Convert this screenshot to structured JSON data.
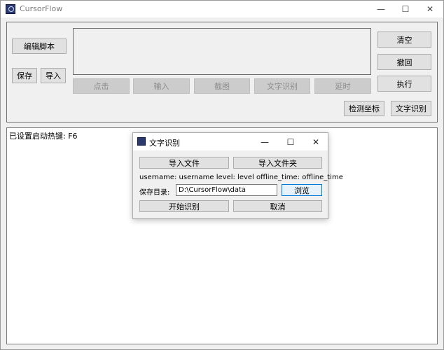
{
  "window": {
    "title": "CursorFlow",
    "minimize": "—",
    "maximize": "☐",
    "close": "✕"
  },
  "left_buttons": {
    "edit_script": "编辑脚本",
    "save": "保存",
    "import": "导入"
  },
  "action_buttons": [
    "点击",
    "输入",
    "截图",
    "文字识别",
    "延时"
  ],
  "right_buttons": {
    "clear": "清空",
    "undo": "撤回",
    "execute": "执行",
    "detect_coords": "检测坐标",
    "ocr": "文字识别"
  },
  "log": {
    "line1": "已设置启动热键: F6"
  },
  "dialog": {
    "title": "文字识别",
    "minimize": "—",
    "maximize": "☐",
    "close": "✕",
    "import_file": "导入文件",
    "import_folder": "导入文件夹",
    "info": "username: username  level: level  offline_time: offline_time",
    "save_dir_label": "保存目录:",
    "save_dir_value": "D:\\CursorFlow\\data",
    "browse": "浏览",
    "start": "开始识别",
    "cancel": "取消"
  },
  "colors": {
    "focus_border": "#0078d7",
    "app_icon": "#2a3a6e"
  }
}
